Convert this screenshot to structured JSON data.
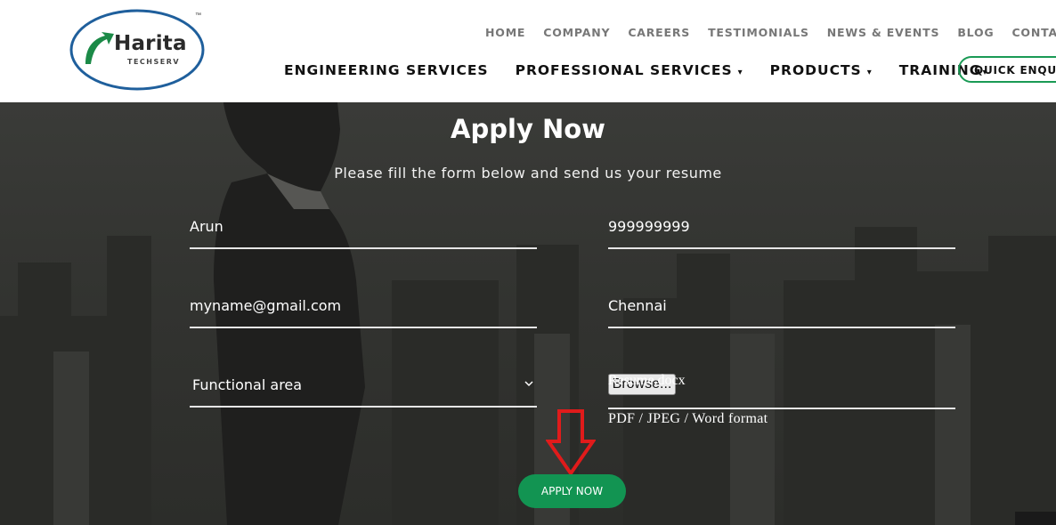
{
  "logo": {
    "name": "Harita",
    "sub": "TECHSERV",
    "tm": "™"
  },
  "top_nav": [
    "HOME",
    "COMPANY",
    "CAREERS",
    "TESTIMONIALS",
    "NEWS & EVENTS",
    "BLOG",
    "CONTACT US"
  ],
  "main_nav": [
    {
      "label": "ENGINEERING SERVICES",
      "caret": ""
    },
    {
      "label": "PROFESSIONAL SERVICES",
      "caret": "▾"
    },
    {
      "label": "PRODUCTS",
      "caret": "▾"
    },
    {
      "label": "TRAINING",
      "caret": "▾"
    }
  ],
  "quick_enquiry": "QUICK ENQUIRY",
  "hero": {
    "title": "Apply Now",
    "subtitle": "Please fill the form below and send us your resume"
  },
  "form": {
    "name": "Arun",
    "phone": "999999999",
    "email": "myname@gmail.com",
    "city": "Chennai",
    "functional_area": "Functional area",
    "browse_label": "Browse...",
    "file_name": "Resume.docx",
    "file_hint": "PDF / JPEG / Word format",
    "submit": "APPLY NOW"
  },
  "colors": {
    "accent": "#129452",
    "arrow": "#e01b1b",
    "logo_ring": "#1f5f9c"
  }
}
